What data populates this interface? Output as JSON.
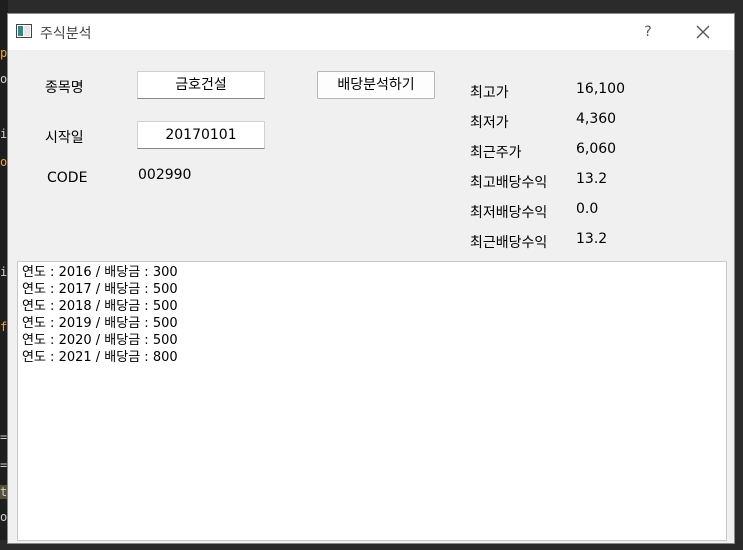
{
  "window": {
    "title": "주식분석",
    "help": "?",
    "close": "✕"
  },
  "form": {
    "stock_name_label": "종목명",
    "stock_name_value": "금호건설",
    "start_date_label": "시작일",
    "start_date_value": "20170101",
    "code_label": "CODE",
    "code_value": "002990",
    "analyze_button": "배당분석하기"
  },
  "stats": [
    {
      "label": "최고가",
      "value": "16,100"
    },
    {
      "label": "최저가",
      "value": "4,360"
    },
    {
      "label": "최근주가",
      "value": "6,060"
    },
    {
      "label": "최고배당수익",
      "value": "13.2"
    },
    {
      "label": "최저배당수익",
      "value": "0.0"
    },
    {
      "label": "최근배당수익",
      "value": "13.2"
    }
  ],
  "output_lines": [
    "연도 : 2016 / 배당금 : 300",
    "연도 : 2017 / 배당금 : 500",
    "연도 : 2018 / 배당금 : 500",
    "연도 : 2019 / 배당금 : 500",
    "연도 : 2020 / 배당금 : 500",
    "연도 : 2021 / 배당금 : 800"
  ],
  "background_code_fragments": [
    "p",
    "o",
    "i",
    "o",
    "i",
    "f",
    "=",
    "=",
    "t",
    "ou"
  ],
  "colors": {
    "window_bg": "#f0f0f0",
    "titlebar": "#ffffff",
    "editor_bg": "#2b2b2b"
  }
}
